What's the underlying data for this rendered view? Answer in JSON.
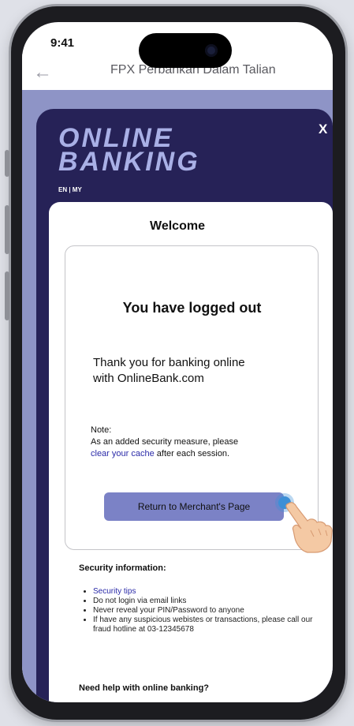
{
  "status_bar": {
    "time": "9:41"
  },
  "header": {
    "title": "FPX Perbankan Dalam Talian",
    "back_icon": "back-arrow-icon"
  },
  "bank": {
    "brand_line1": "ONLINE",
    "brand_line2": "BANKING",
    "language": "EN | MY",
    "close_label": "X"
  },
  "card": {
    "welcome": "Welcome",
    "logout_title": "You have logged out",
    "thanks_line1": "Thank you for banking online",
    "thanks_line2": "with OnlineBank.com",
    "note_label": "Note:",
    "note_line1": "As an added security measure, please",
    "note_link": "clear your cache",
    "note_tail": " after each session.",
    "return_button": "Return to Merchant's Page"
  },
  "security": {
    "heading": "Security information:",
    "items": [
      "Security tips",
      "Do not login via email links",
      "Never reveal your PIN/Password to anyone",
      "If have any suspicious webistes or transactions, please call our fraud hotline at 03-12345678"
    ],
    "help_heading": "Need help with online banking?"
  },
  "colors": {
    "panel": "#262257",
    "frame_bg": "#8e94c6",
    "brand_text": "#a9b0e6",
    "button": "#7b82c6",
    "link": "#2a2aa8"
  }
}
